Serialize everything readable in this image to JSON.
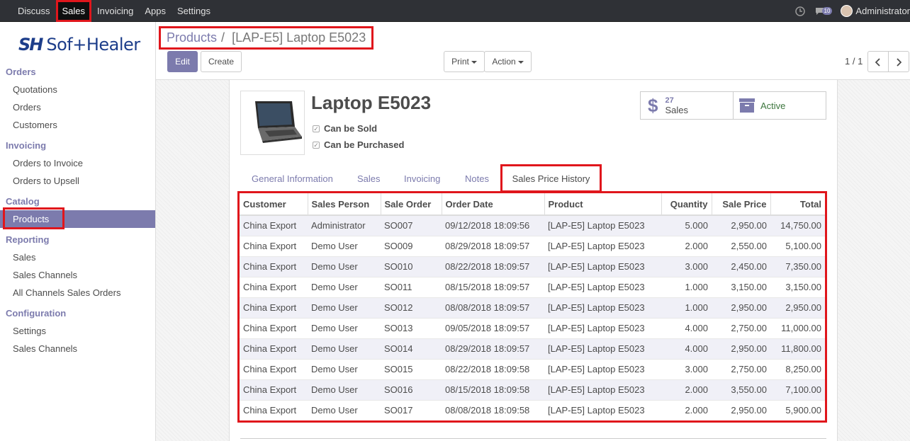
{
  "topbar": {
    "menu": [
      "Discuss",
      "Sales",
      "Invoicing",
      "Apps",
      "Settings"
    ],
    "active": "Sales",
    "chat_count": "10",
    "user": "Administrator"
  },
  "sidebar": {
    "logo_mark": "SH",
    "logo_text": "Sof+Healer",
    "groups": [
      {
        "title": "Orders",
        "items": [
          "Quotations",
          "Orders",
          "Customers"
        ]
      },
      {
        "title": "Invoicing",
        "items": [
          "Orders to Invoice",
          "Orders to Upsell"
        ]
      },
      {
        "title": "Catalog",
        "items": [
          "Products"
        ]
      },
      {
        "title": "Reporting",
        "items": [
          "Sales",
          "Sales Channels",
          "All Channels Sales Orders"
        ]
      },
      {
        "title": "Configuration",
        "items": [
          "Settings",
          "Sales Channels"
        ]
      }
    ]
  },
  "breadcrumb": {
    "parent": "Products",
    "separator": "/",
    "current": "[LAP-E5] Laptop E5023"
  },
  "buttons": {
    "edit": "Edit",
    "create": "Create",
    "print": "Print",
    "action": "Action"
  },
  "pager": {
    "value": "1 / 1"
  },
  "product": {
    "name": "Laptop E5023",
    "can_be_sold": "Can be Sold",
    "can_be_purchased": "Can be Purchased",
    "sales_count": "27",
    "sales_label": "Sales",
    "active_label": "Active"
  },
  "tabs": [
    "General Information",
    "Sales",
    "Invoicing",
    "Notes",
    "Sales Price History"
  ],
  "table": {
    "headers": [
      "Customer",
      "Sales Person",
      "Sale Order",
      "Order Date",
      "Product",
      "Quantity",
      "Sale Price",
      "Total"
    ],
    "rows": [
      [
        "China Export",
        "Administrator",
        "SO007",
        "09/12/2018 18:09:56",
        "[LAP-E5] Laptop E5023",
        "5.000",
        "2,950.00",
        "14,750.00"
      ],
      [
        "China Export",
        "Demo User",
        "SO009",
        "08/29/2018 18:09:57",
        "[LAP-E5] Laptop E5023",
        "2.000",
        "2,550.00",
        "5,100.00"
      ],
      [
        "China Export",
        "Demo User",
        "SO010",
        "08/22/2018 18:09:57",
        "[LAP-E5] Laptop E5023",
        "3.000",
        "2,450.00",
        "7,350.00"
      ],
      [
        "China Export",
        "Demo User",
        "SO011",
        "08/15/2018 18:09:57",
        "[LAP-E5] Laptop E5023",
        "1.000",
        "3,150.00",
        "3,150.00"
      ],
      [
        "China Export",
        "Demo User",
        "SO012",
        "08/08/2018 18:09:57",
        "[LAP-E5] Laptop E5023",
        "1.000",
        "2,950.00",
        "2,950.00"
      ],
      [
        "China Export",
        "Demo User",
        "SO013",
        "09/05/2018 18:09:57",
        "[LAP-E5] Laptop E5023",
        "4.000",
        "2,750.00",
        "11,000.00"
      ],
      [
        "China Export",
        "Demo User",
        "SO014",
        "08/29/2018 18:09:57",
        "[LAP-E5] Laptop E5023",
        "4.000",
        "2,950.00",
        "11,800.00"
      ],
      [
        "China Export",
        "Demo User",
        "SO015",
        "08/22/2018 18:09:58",
        "[LAP-E5] Laptop E5023",
        "3.000",
        "2,750.00",
        "8,250.00"
      ],
      [
        "China Export",
        "Demo User",
        "SO016",
        "08/15/2018 18:09:58",
        "[LAP-E5] Laptop E5023",
        "2.000",
        "3,550.00",
        "7,100.00"
      ],
      [
        "China Export",
        "Demo User",
        "SO017",
        "08/08/2018 18:09:58",
        "[LAP-E5] Laptop E5023",
        "2.000",
        "2,950.00",
        "5,900.00"
      ]
    ]
  },
  "colors": {
    "accent": "#7c7bad",
    "highlight": "#e0161c",
    "navbar": "#2f3136"
  }
}
